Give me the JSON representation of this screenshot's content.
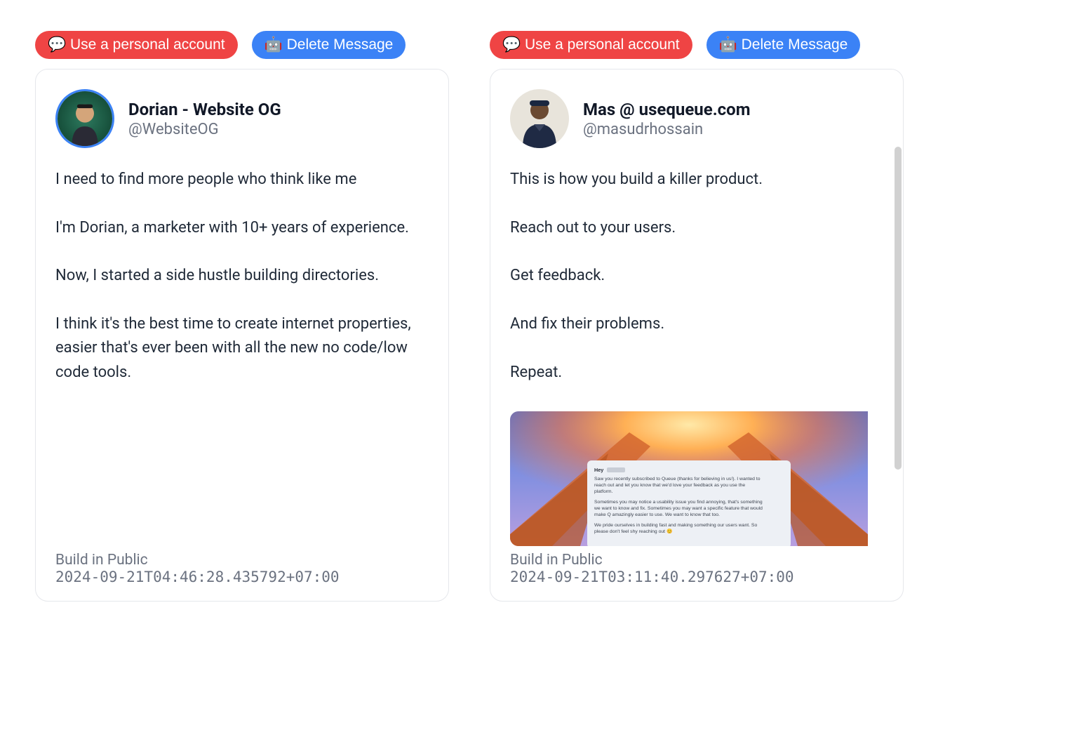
{
  "buttons": {
    "personal_account": "💬 Use a personal account",
    "delete_message": "🤖 Delete Message"
  },
  "cards": [
    {
      "display_name": "Dorian - Website OG",
      "username": "@WebsiteOG",
      "body": "I need to find more people who think like me\n\nI'm Dorian, a marketer with 10+ years of experience.\n\nNow, I started a side hustle building directories.\n\nI think it's the best time to create internet properties, easier that's ever been with all the new no code/low code tools.",
      "footer_label": "Build in Public",
      "timestamp": "2024-09-21T04:46:28.435792+07:00"
    },
    {
      "display_name": "Mas @ usequeue.com",
      "username": "@masudrhossain",
      "body": "This is how you build a killer product.\n\nReach out to your users.\n\nGet feedback.\n\nAnd fix their problems.\n\nRepeat.",
      "footer_label": "Build in Public",
      "timestamp": "2024-09-21T03:11:40.297627+07:00",
      "embedded_message": {
        "greeting": "Hey",
        "line1": "Saw you recently subscribed to Queue (thanks for believing in us!). I wanted to reach out and let you know that we'd love your feedback as you use the platform.",
        "line2": "Sometimes you may notice a usability issue you find annoying, that's something we want to know and fix. Sometimes you may want a specific feature that would make Q amazingly easier to use. We want to know that too.",
        "line3": "We pride ourselves in building fast and making something our users want. So please don't feel shy reaching out 😊"
      }
    }
  ]
}
